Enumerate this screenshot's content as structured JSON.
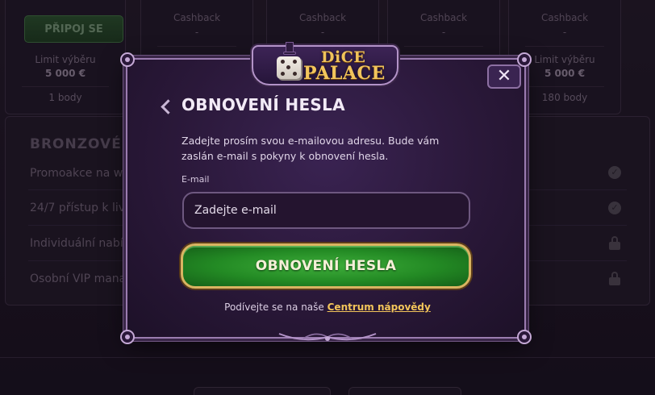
{
  "background": {
    "join_button": "PŘIPOJ SE",
    "cards": [
      {
        "cashback_label": "",
        "cashback_value": "",
        "limit_label": "Limit výběru",
        "limit_value": "5 000 €",
        "points": "1 body"
      },
      {
        "cashback_label": "Cashback",
        "cashback_value": "-",
        "limit_label": "",
        "limit_value": "",
        "points": ""
      },
      {
        "cashback_label": "Cashback",
        "cashback_value": "-",
        "limit_label": "",
        "limit_value": "",
        "points": ""
      },
      {
        "cashback_label": "Cashback",
        "cashback_value": "-",
        "limit_label": "",
        "limit_value": "",
        "points": ""
      },
      {
        "cashback_label": "Cashback",
        "cashback_value": "-",
        "limit_label": "Limit výběru",
        "limit_value": "5 000 €",
        "points": "180 body"
      }
    ],
    "section_title": "BRONZOVÉ V",
    "rows": [
      "Promoakce na we",
      "24/7 přístup k live",
      "Individuální nabíd",
      "Osobní VIP mana"
    ]
  },
  "logo": {
    "line1": "DiCE",
    "line2": "PALACE"
  },
  "modal": {
    "close_symbol": "✕",
    "title": "OBNOVENÍ HESLA",
    "description": "Zadejte prosím svou e-mailovou adresu. Bude vám zaslán e-mail s pokyny k obnovení hesla.",
    "email_label": "E-mail",
    "email_placeholder": "Zadejte e-mail",
    "submit_label": "OBNOVENÍ HESLA",
    "help_prefix": "Podívejte se na naše",
    "help_link": "Centrum nápovědy"
  },
  "colors": {
    "accent_gold": "#f3c55a",
    "button_green": "#238a24",
    "panel_purple": "#2a1839"
  }
}
